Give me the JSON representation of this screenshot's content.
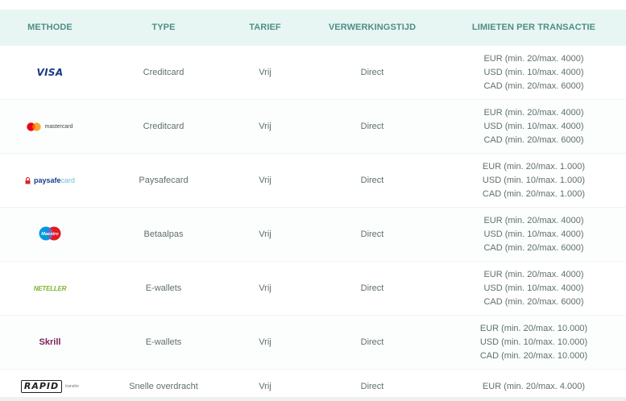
{
  "table": {
    "headers": [
      "METHODE",
      "TYPE",
      "TARIEF",
      "VERWERKINGSTIJD",
      "LIMIETEN PER TRANSACTIE"
    ],
    "rows": [
      {
        "method": "VISA",
        "type": "Creditcard",
        "fee": "Vrij",
        "time": "Direct",
        "limits": [
          "EUR (min. 20/max. 4000)",
          "USD (min. 10/max. 4000)",
          "CAD (min. 20/max. 6000)"
        ]
      },
      {
        "method": "mastercard",
        "type": "Creditcard",
        "fee": "Vrij",
        "time": "Direct",
        "limits": [
          "EUR (min. 20/max. 4000)",
          "USD (min. 10/max. 4000)",
          "CAD (min. 20/max. 6000)"
        ]
      },
      {
        "method": "paysafe",
        "method_suffix": "card",
        "type": "Paysafecard",
        "fee": "Vrij",
        "time": "Direct",
        "limits": [
          "EUR (min. 20/max. 1.000)",
          "USD (min. 10/max. 1.000)",
          "CAD (min. 20/max. 1.000)"
        ]
      },
      {
        "method": "Maestro",
        "type": "Betaalpas",
        "fee": "Vrij",
        "time": "Direct",
        "limits": [
          "EUR (min. 20/max. 4000)",
          "USD (min. 10/max. 4000)",
          "CAD (min. 20/max. 6000)"
        ]
      },
      {
        "method": "NETELLER",
        "type": "E-wallets",
        "fee": "Vrij",
        "time": "Direct",
        "limits": [
          "EUR (min. 20/max. 4000)",
          "USD (min. 10/max. 4000)",
          "CAD (min. 20/max. 6000)"
        ]
      },
      {
        "method": "Skrill",
        "type": "E-wallets",
        "fee": "Vrij",
        "time": "Direct",
        "limits": [
          "EUR (min. 20/max. 10.000)",
          "USD (min. 10/max. 10.000)",
          "CAD (min. 20/max. 10.000)"
        ]
      },
      {
        "method": "RAPID",
        "method_suffix": "transfer",
        "type": "Snelle overdracht",
        "fee": "Vrij",
        "time": "Direct",
        "limits": [
          "EUR (min. 20/max. 4.000)"
        ]
      }
    ]
  },
  "colors": {
    "header_bg": "#e7f6f2",
    "header_text": "#4f8d89",
    "body_text": "#5f6f6e",
    "visa": "#1a3a85",
    "mastercard_red": "#eb001b",
    "mastercard_orange": "#f79e1b",
    "paysafecard": "#1a3f87",
    "maestro_blue": "#0099df",
    "maestro_red": "#e11b22",
    "neteller": "#7ab72f",
    "skrill": "#7b2259"
  },
  "icons": {
    "paysafecard": "lock-icon",
    "mastercard": "mastercard-circles-icon",
    "maestro": "maestro-circles-icon"
  }
}
